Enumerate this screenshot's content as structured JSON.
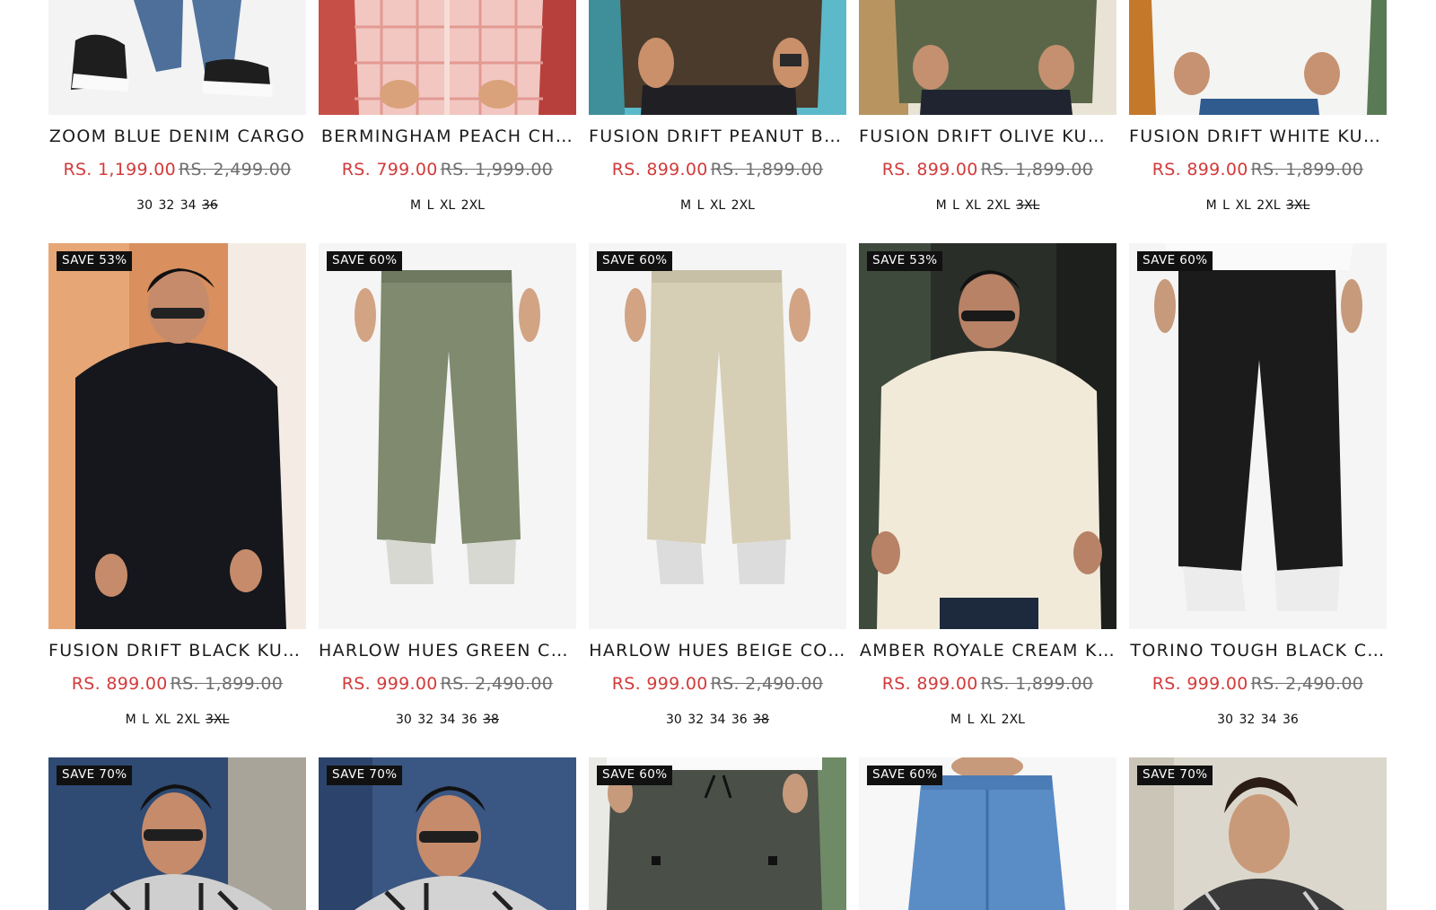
{
  "colors": {
    "accent": "#d23b3b",
    "badge_bg": "#111111",
    "text": "#1b1b1b"
  },
  "rows": [
    [
      {
        "title": "ZOOM BLUE DENIM CARGO",
        "price": "RS. 1,199.00",
        "compare": "RS. 2,499.00",
        "sizes": [
          "30",
          "32",
          "34"
        ],
        "sizes_na": [
          "36"
        ],
        "image": "denim-sneakers"
      },
      {
        "title": "BERMINGHAM PEACH CH…",
        "price": "RS. 799.00",
        "compare": "RS. 1,999.00",
        "sizes": [
          "M",
          "L",
          "XL",
          "2XL"
        ],
        "sizes_na": [],
        "image": "peach-check-shirt"
      },
      {
        "title": "FUSION DRIFT PEANUT BR…",
        "price": "RS. 899.00",
        "compare": "RS. 1,899.00",
        "sizes": [
          "M",
          "L",
          "XL",
          "2XL"
        ],
        "sizes_na": [],
        "image": "brown-kurta"
      },
      {
        "title": "FUSION DRIFT OLIVE KUR…",
        "price": "RS. 899.00",
        "compare": "RS. 1,899.00",
        "sizes": [
          "M",
          "L",
          "XL",
          "2XL"
        ],
        "sizes_na": [
          "3XL"
        ],
        "image": "olive-kurta"
      },
      {
        "title": "FUSION DRIFT WHITE KUR…",
        "price": "RS. 899.00",
        "compare": "RS. 1,899.00",
        "sizes": [
          "M",
          "L",
          "XL",
          "2XL"
        ],
        "sizes_na": [
          "3XL"
        ],
        "image": "white-kurta"
      }
    ],
    [
      {
        "badge": "SAVE 53%",
        "title": "FUSION DRIFT BLACK KUR…",
        "price": "RS. 899.00",
        "compare": "RS. 1,899.00",
        "sizes": [
          "M",
          "L",
          "XL",
          "2XL"
        ],
        "sizes_na": [
          "3XL"
        ],
        "image": "black-kurta"
      },
      {
        "badge": "SAVE 60%",
        "title": "HARLOW HUES GREEN CO…",
        "price": "RS. 999.00",
        "compare": "RS. 2,490.00",
        "sizes": [
          "30",
          "32",
          "34",
          "36"
        ],
        "sizes_na": [
          "38"
        ],
        "image": "green-cargo"
      },
      {
        "badge": "SAVE 60%",
        "title": "HARLOW HUES BEIGE CO…",
        "price": "RS. 999.00",
        "compare": "RS. 2,490.00",
        "sizes": [
          "30",
          "32",
          "34",
          "36"
        ],
        "sizes_na": [
          "38"
        ],
        "image": "beige-cargo"
      },
      {
        "badge": "SAVE 53%",
        "title": "AMBER ROYALE CREAM K…",
        "price": "RS. 899.00",
        "compare": "RS. 1,899.00",
        "sizes": [
          "M",
          "L",
          "XL",
          "2XL"
        ],
        "sizes_na": [],
        "image": "cream-kurta"
      },
      {
        "badge": "SAVE 60%",
        "title": "TORINO TOUGH BLACK C…",
        "price": "RS. 999.00",
        "compare": "RS. 2,490.00",
        "sizes": [
          "30",
          "32",
          "34",
          "36"
        ],
        "sizes_na": [],
        "image": "black-cargo"
      }
    ],
    [
      {
        "badge": "SAVE 70%",
        "image": "checked-shirt-1"
      },
      {
        "badge": "SAVE 70%",
        "image": "checked-shirt-2"
      },
      {
        "badge": "SAVE 60%",
        "image": "olive-joggers"
      },
      {
        "badge": "SAVE 60%",
        "image": "blue-jeans"
      },
      {
        "badge": "SAVE 70%",
        "image": "checked-shirt-3"
      }
    ]
  ]
}
